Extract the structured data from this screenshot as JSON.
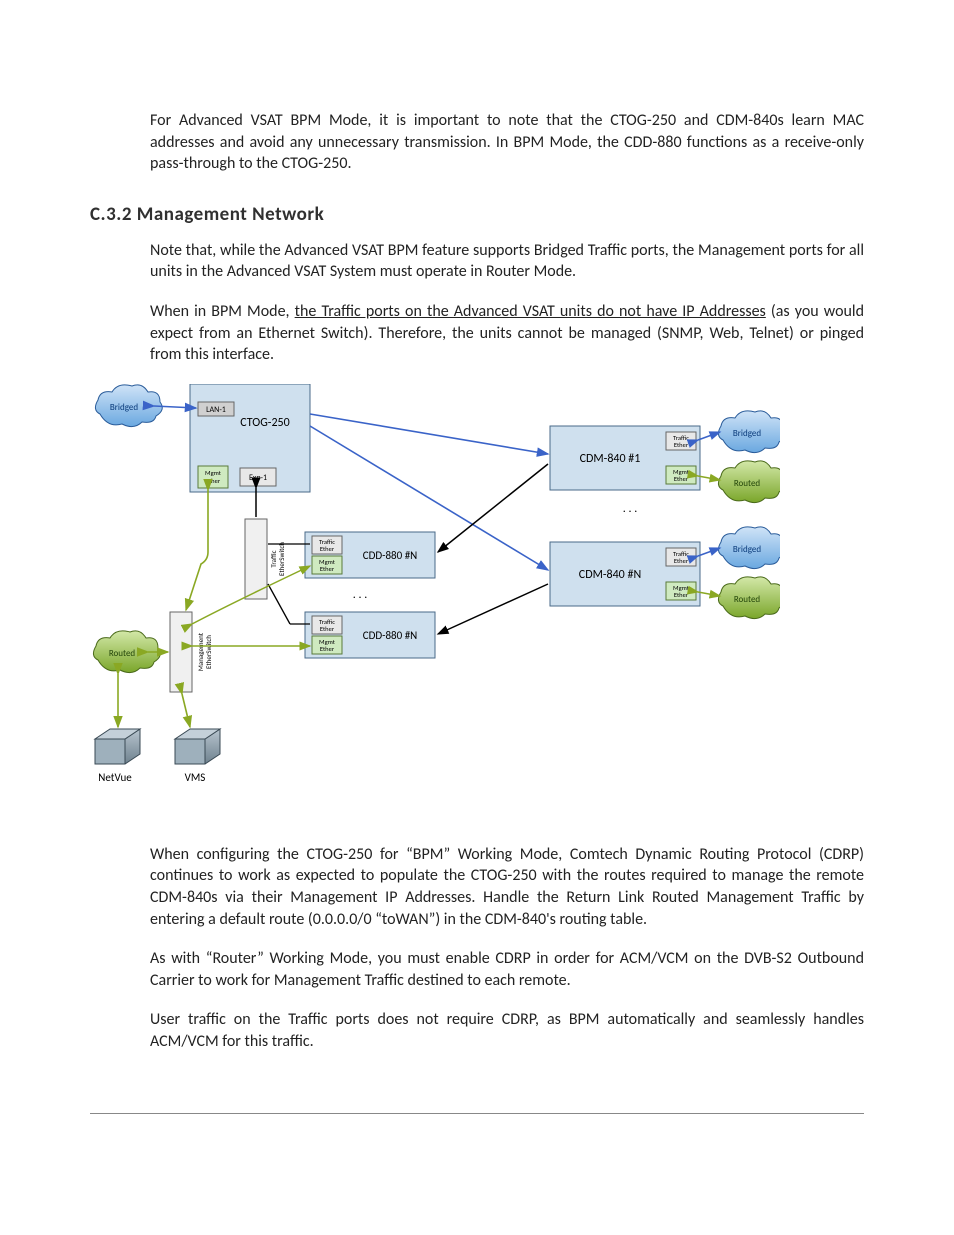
{
  "paragraphs": {
    "p1": "For Advanced VSAT BPM Mode, it is important to note that the CTOG-250 and CDM-840s learn MAC addresses and avoid any unnecessary transmission. In BPM Mode, the CDD-880 functions as a receive-only pass-through to the CTOG-250.",
    "heading": "C.3.2  Management Network",
    "p2": "Note that, while the Advanced VSAT BPM feature supports Bridged Traffic ports, the Management ports for all units in the Advanced VSAT System must operate in Router Mode.",
    "p3a": "When in BPM Mode, ",
    "p3u": "the Traffic ports on the Advanced VSAT units do not have IP Addresses",
    "p3b": " (as you would expect from an Ethernet Switch). Therefore, the units cannot be managed (SNMP, Web, Telnet) or pinged from this interface.",
    "p4": "When configuring the CTOG-250 for “BPM” Working Mode, Comtech Dynamic Routing Protocol (CDRP) continues to work as expected to populate the CTOG-250 with the routes required to manage the remote CDM-840s via their Management IP Addresses. Handle the Return Link Routed Management Traffic by entering a default route (0.0.0.0/0 “toWAN”) in the CDM-840's routing table.",
    "p5": "As with “Router” Working Mode, you must enable CDRP in order for ACM/VCM on the DVB-S2 Outbound Carrier to work for Management Traffic destined to each remote.",
    "p6": "User traffic on the Traffic ports does not require CDRP, as BPM automatically and seamlessly handles ACM/VCM for this traffic."
  },
  "diagram": {
    "clouds": {
      "bridged": "Bridged",
      "routed": "Routed"
    },
    "boxes": {
      "ctog": "CTOG-250",
      "lan1": "LAN-1",
      "mgmt_ether": "Mgmt\nEther",
      "exp1": "Exp-1",
      "traffic_etherswitch": "Traffic\nEtherSwitch",
      "mgmt_etherswitch": "Management\nEtherSwitch",
      "traffic_ether": "Traffic\nEther",
      "cdd880_n_a": "CDD-880 #N",
      "cdd880_n_b": "CDD-880 #N",
      "cdm840_1": "CDM-840 #1",
      "cdm840_n": "CDM-840 #N",
      "netvue": "NetVue",
      "vms": "VMS",
      "ellipsis": ". . ."
    }
  }
}
